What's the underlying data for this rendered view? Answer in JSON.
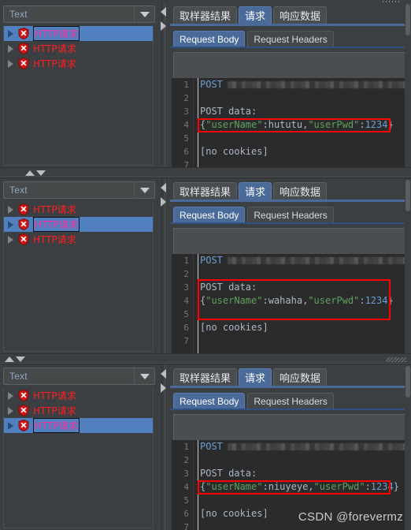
{
  "app": {
    "watermark": "CSDN @forevermz"
  },
  "panels": [
    {
      "filter": {
        "value": "Text",
        "placeholder": "Text"
      },
      "tree": {
        "items": [
          {
            "label": "HTTP请求",
            "selected": true
          },
          {
            "label": "HTTP请求",
            "selected": false
          },
          {
            "label": "HTTP请求",
            "selected": false
          }
        ]
      },
      "tabs": [
        {
          "label": "取样器结果",
          "active": false
        },
        {
          "label": "请求",
          "active": true
        },
        {
          "label": "响应数据",
          "active": false
        }
      ],
      "subtabs": [
        {
          "label": "Request Body",
          "active": true
        },
        {
          "label": "Request Headers",
          "active": false
        }
      ],
      "search": {
        "value": "",
        "placeholder": ""
      },
      "code": {
        "line_numbers": [
          "1",
          "2",
          "3",
          "4",
          "5",
          "6",
          "7"
        ],
        "lines": [
          {
            "kind": "post",
            "text": "POST",
            "redacted": true
          },
          {
            "kind": "blank",
            "text": ""
          },
          {
            "kind": "plain",
            "text": "POST data:"
          },
          {
            "kind": "json",
            "brace_open": "{",
            "key1": "\"userName\"",
            "sep1": ":",
            "val1": "hututu",
            "comma": ",",
            "key2": "\"userPwd\"",
            "sep2": ":",
            "val2": "1234",
            "brace_close": "}"
          },
          {
            "kind": "blank",
            "text": ""
          },
          {
            "kind": "plain",
            "text": "[no cookies]"
          },
          {
            "kind": "blank",
            "text": ""
          }
        ],
        "highlight": {
          "from_line": 4,
          "to_line": 4
        }
      }
    },
    {
      "filter": {
        "value": "Text",
        "placeholder": "Text"
      },
      "tree": {
        "items": [
          {
            "label": "HTTP请求",
            "selected": false
          },
          {
            "label": "HTTP请求",
            "selected": true
          },
          {
            "label": "HTTP请求",
            "selected": false
          }
        ]
      },
      "tabs": [
        {
          "label": "取样器结果",
          "active": false
        },
        {
          "label": "请求",
          "active": true
        },
        {
          "label": "响应数据",
          "active": false
        }
      ],
      "subtabs": [
        {
          "label": "Request Body",
          "active": true
        },
        {
          "label": "Request Headers",
          "active": false
        }
      ],
      "search": {
        "value": "",
        "placeholder": ""
      },
      "code": {
        "line_numbers": [
          "1",
          "2",
          "3",
          "4",
          "5",
          "6",
          "7"
        ],
        "lines": [
          {
            "kind": "post",
            "text": "POST",
            "redacted": true
          },
          {
            "kind": "blank",
            "text": ""
          },
          {
            "kind": "plain",
            "text": "POST data:"
          },
          {
            "kind": "json",
            "brace_open": "{",
            "key1": "\"userName\"",
            "sep1": ":",
            "val1": "wahaha",
            "comma": ",",
            "key2": "\"userPwd\"",
            "sep2": ":",
            "val2": "1234",
            "brace_close": "}"
          },
          {
            "kind": "blank",
            "text": ""
          },
          {
            "kind": "plain",
            "text": "[no cookies]"
          },
          {
            "kind": "blank",
            "text": ""
          }
        ],
        "highlight": {
          "from_line": 3,
          "to_line": 5
        }
      }
    },
    {
      "filter": {
        "value": "Text",
        "placeholder": "Text"
      },
      "tree": {
        "items": [
          {
            "label": "HTTP请求",
            "selected": false
          },
          {
            "label": "HTTP请求",
            "selected": false
          },
          {
            "label": "HTTP请求",
            "selected": true
          }
        ]
      },
      "tabs": [
        {
          "label": "取样器结果",
          "active": false
        },
        {
          "label": "请求",
          "active": true
        },
        {
          "label": "响应数据",
          "active": false
        }
      ],
      "subtabs": [
        {
          "label": "Request Body",
          "active": true
        },
        {
          "label": "Request Headers",
          "active": false
        }
      ],
      "search": {
        "value": "",
        "placeholder": ""
      },
      "code": {
        "line_numbers": [
          "1",
          "2",
          "3",
          "4",
          "5",
          "6",
          "7"
        ],
        "lines": [
          {
            "kind": "post",
            "text": "POST",
            "redacted": true
          },
          {
            "kind": "blank",
            "text": ""
          },
          {
            "kind": "plain",
            "text": "POST data:"
          },
          {
            "kind": "json",
            "brace_open": "{",
            "key1": "\"userName\"",
            "sep1": ":",
            "val1": "niuyeye",
            "comma": ",",
            "key2": "\"userPwd\"",
            "sep2": ":",
            "val2": "1234",
            "brace_close": "}"
          },
          {
            "kind": "blank",
            "text": ""
          },
          {
            "kind": "plain",
            "text": "[no cookies]"
          },
          {
            "kind": "blank",
            "text": ""
          }
        ],
        "highlight": {
          "from_line": 4,
          "to_line": 4
        }
      }
    }
  ],
  "colors": {
    "selection_blue": "#5180c0",
    "tab_active": "#4a6a99",
    "node_red": "#ff1f1f",
    "highlight_red": "#ff0000",
    "json_key_green": "#5fa05f",
    "code_blue": "#6a9fd4",
    "panel_bg": "#3c3f41",
    "code_bg": "#2b2b2b"
  }
}
